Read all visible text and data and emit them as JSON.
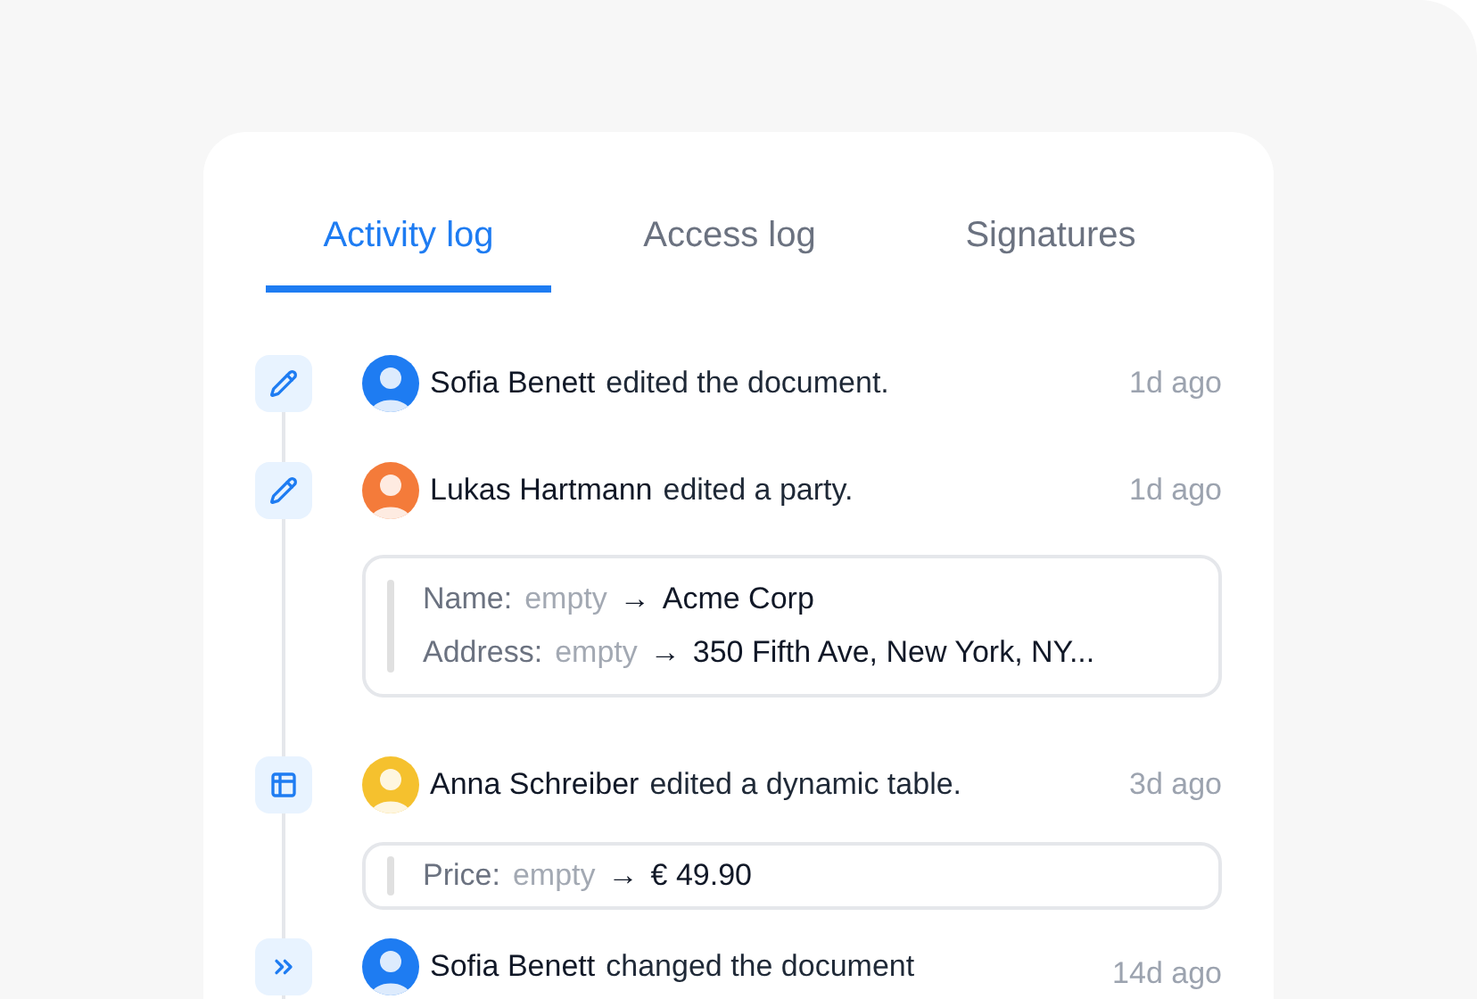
{
  "tabs": [
    {
      "label": "Activity log",
      "selected": true
    },
    {
      "label": "Access log",
      "selected": false
    },
    {
      "label": "Signatures",
      "selected": false
    }
  ],
  "entries": [
    {
      "kind": "edit",
      "color": "#1e7cf2",
      "name": "Sofia Benett",
      "action": "edited the document.",
      "time": "1d ago"
    },
    {
      "kind": "edit",
      "color": "#f47b3a",
      "name": "Lukas Hartmann",
      "action": "edited a party.",
      "time": "1d ago",
      "changes": [
        {
          "label": "Name:",
          "old": "empty",
          "arrow": "→",
          "new": "Acme Corp"
        },
        {
          "label": "Address:",
          "old": "empty",
          "arrow": "→",
          "new": "350 Fifth Ave, New York, NY..."
        }
      ]
    },
    {
      "kind": "table",
      "color": "#f5c12e",
      "name": "Anna Schreiber",
      "action": "edited a dynamic table.",
      "time": "3d ago",
      "changes": [
        {
          "label": "Price:",
          "old": "empty",
          "arrow": "→",
          "new": "€ 49.90"
        }
      ]
    },
    {
      "kind": "forward",
      "color": "#1e7cf2",
      "name": "Sofia Benett",
      "action": "changed the document",
      "time": "14d ago"
    }
  ]
}
